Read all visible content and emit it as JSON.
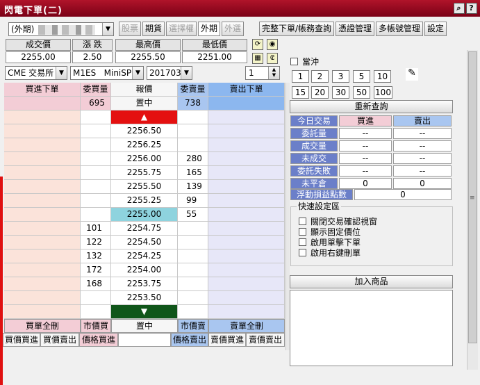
{
  "window": {
    "title": "閃電下單(二)",
    "help": "?",
    "close": "×"
  },
  "toolbar": {
    "account_prefix": "(外期)",
    "tabs": [
      {
        "label": "股票",
        "disabled": true
      },
      {
        "label": "期貨",
        "disabled": false
      },
      {
        "label": "選擇權",
        "disabled": true
      },
      {
        "label": "外期",
        "disabled": false
      },
      {
        "label": "外選",
        "disabled": true
      }
    ],
    "actions": [
      "完整下單/帳務查詢",
      "憑證管理",
      "多帳號管理",
      "設定"
    ]
  },
  "quote": {
    "headers": [
      "成交價",
      "漲 跌",
      "最高價",
      "最低價"
    ],
    "values": [
      "2255.00",
      "2.50",
      "2255.50",
      "2251.00"
    ]
  },
  "selectors": {
    "exchange": "CME 交易所",
    "symbol": "M1ES   MiniSP",
    "month": "201703",
    "qty": "1"
  },
  "ladder": {
    "headers": {
      "buy_order": "買進下單",
      "bid_qty": "委買量",
      "price": "報價",
      "ask_qty": "委賣量",
      "sell_order": "賣出下單"
    },
    "totals": {
      "bid": "695",
      "center": "置中",
      "ask": "738"
    },
    "up_arrow": "▲",
    "down_arrow": "▼",
    "rows": [
      {
        "price": "2256.50",
        "bid": "",
        "ask": ""
      },
      {
        "price": "2256.25",
        "bid": "",
        "ask": ""
      },
      {
        "price": "2256.00",
        "bid": "",
        "ask": "280"
      },
      {
        "price": "2255.75",
        "bid": "",
        "ask": "165"
      },
      {
        "price": "2255.50",
        "bid": "",
        "ask": "139"
      },
      {
        "price": "2255.25",
        "bid": "",
        "ask": "99"
      },
      {
        "price": "2255.00",
        "bid": "",
        "ask": "55",
        "highlight": true
      },
      {
        "price": "2254.75",
        "bid": "101",
        "ask": ""
      },
      {
        "price": "2254.50",
        "bid": "122",
        "ask": ""
      },
      {
        "price": "2254.25",
        "bid": "132",
        "ask": ""
      },
      {
        "price": "2254.00",
        "bid": "172",
        "ask": ""
      },
      {
        "price": "2253.75",
        "bid": "168",
        "ask": ""
      },
      {
        "price": "2253.50",
        "bid": "",
        "ask": ""
      },
      {
        "price": "",
        "bid": "",
        "ask": ""
      }
    ],
    "footer1": {
      "buy_cancel": "買單全刪",
      "mkt_buy": "市價買",
      "center": "置中",
      "mkt_sell": "市價賣",
      "sell_cancel": "賣單全刪"
    },
    "footer2": {
      "b1": "買價買進",
      "b2": "買價賣出",
      "b3": "價格買進",
      "s1": "價格賣出",
      "s2": "賣價買進",
      "s3": "賣價賣出"
    }
  },
  "right": {
    "daytrade_label": "當沖",
    "qty_row1": [
      "1",
      "2",
      "3",
      "5",
      "10"
    ],
    "qty_row2": [
      "15",
      "20",
      "30",
      "50",
      "100"
    ],
    "requery": "重新查詢",
    "stats": {
      "header": {
        "label": "今日交易",
        "buy": "買進",
        "sell": "賣出"
      },
      "rows": [
        {
          "label": "委託量",
          "buy": "--",
          "sell": "--"
        },
        {
          "label": "成交量",
          "buy": "--",
          "sell": "--"
        },
        {
          "label": "未成交",
          "buy": "--",
          "sell": "--"
        },
        {
          "label": "委託失敗",
          "buy": "--",
          "sell": "--"
        },
        {
          "label": "未平倉",
          "buy": "0",
          "sell": "0"
        }
      ],
      "pnl_label": "浮動損益點數",
      "pnl_value": "0"
    },
    "quick": {
      "title": "快速設定區",
      "options": [
        "關閉交易確認視窗",
        "顯示固定價位",
        "啟用單擊下單",
        "啟用右鍵刪單"
      ]
    },
    "add_product": "加入商品"
  }
}
